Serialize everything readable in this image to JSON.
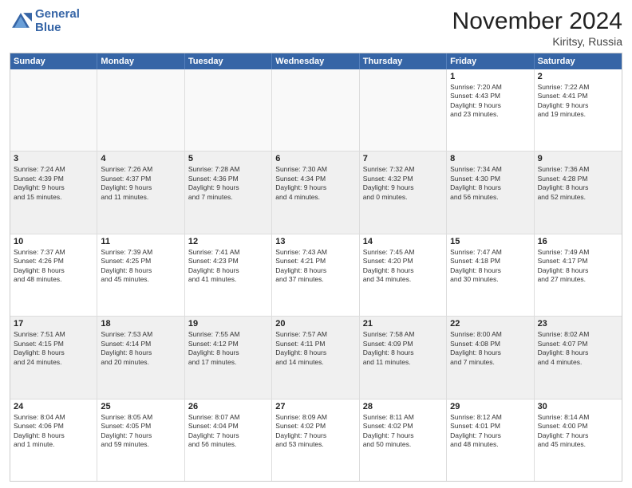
{
  "header": {
    "logo_line1": "General",
    "logo_line2": "Blue",
    "month_title": "November 2024",
    "location": "Kiritsy, Russia"
  },
  "weekdays": [
    "Sunday",
    "Monday",
    "Tuesday",
    "Wednesday",
    "Thursday",
    "Friday",
    "Saturday"
  ],
  "rows": [
    [
      {
        "day": "",
        "info": ""
      },
      {
        "day": "",
        "info": ""
      },
      {
        "day": "",
        "info": ""
      },
      {
        "day": "",
        "info": ""
      },
      {
        "day": "",
        "info": ""
      },
      {
        "day": "1",
        "info": "Sunrise: 7:20 AM\nSunset: 4:43 PM\nDaylight: 9 hours\nand 23 minutes."
      },
      {
        "day": "2",
        "info": "Sunrise: 7:22 AM\nSunset: 4:41 PM\nDaylight: 9 hours\nand 19 minutes."
      }
    ],
    [
      {
        "day": "3",
        "info": "Sunrise: 7:24 AM\nSunset: 4:39 PM\nDaylight: 9 hours\nand 15 minutes."
      },
      {
        "day": "4",
        "info": "Sunrise: 7:26 AM\nSunset: 4:37 PM\nDaylight: 9 hours\nand 11 minutes."
      },
      {
        "day": "5",
        "info": "Sunrise: 7:28 AM\nSunset: 4:36 PM\nDaylight: 9 hours\nand 7 minutes."
      },
      {
        "day": "6",
        "info": "Sunrise: 7:30 AM\nSunset: 4:34 PM\nDaylight: 9 hours\nand 4 minutes."
      },
      {
        "day": "7",
        "info": "Sunrise: 7:32 AM\nSunset: 4:32 PM\nDaylight: 9 hours\nand 0 minutes."
      },
      {
        "day": "8",
        "info": "Sunrise: 7:34 AM\nSunset: 4:30 PM\nDaylight: 8 hours\nand 56 minutes."
      },
      {
        "day": "9",
        "info": "Sunrise: 7:36 AM\nSunset: 4:28 PM\nDaylight: 8 hours\nand 52 minutes."
      }
    ],
    [
      {
        "day": "10",
        "info": "Sunrise: 7:37 AM\nSunset: 4:26 PM\nDaylight: 8 hours\nand 48 minutes."
      },
      {
        "day": "11",
        "info": "Sunrise: 7:39 AM\nSunset: 4:25 PM\nDaylight: 8 hours\nand 45 minutes."
      },
      {
        "day": "12",
        "info": "Sunrise: 7:41 AM\nSunset: 4:23 PM\nDaylight: 8 hours\nand 41 minutes."
      },
      {
        "day": "13",
        "info": "Sunrise: 7:43 AM\nSunset: 4:21 PM\nDaylight: 8 hours\nand 37 minutes."
      },
      {
        "day": "14",
        "info": "Sunrise: 7:45 AM\nSunset: 4:20 PM\nDaylight: 8 hours\nand 34 minutes."
      },
      {
        "day": "15",
        "info": "Sunrise: 7:47 AM\nSunset: 4:18 PM\nDaylight: 8 hours\nand 30 minutes."
      },
      {
        "day": "16",
        "info": "Sunrise: 7:49 AM\nSunset: 4:17 PM\nDaylight: 8 hours\nand 27 minutes."
      }
    ],
    [
      {
        "day": "17",
        "info": "Sunrise: 7:51 AM\nSunset: 4:15 PM\nDaylight: 8 hours\nand 24 minutes."
      },
      {
        "day": "18",
        "info": "Sunrise: 7:53 AM\nSunset: 4:14 PM\nDaylight: 8 hours\nand 20 minutes."
      },
      {
        "day": "19",
        "info": "Sunrise: 7:55 AM\nSunset: 4:12 PM\nDaylight: 8 hours\nand 17 minutes."
      },
      {
        "day": "20",
        "info": "Sunrise: 7:57 AM\nSunset: 4:11 PM\nDaylight: 8 hours\nand 14 minutes."
      },
      {
        "day": "21",
        "info": "Sunrise: 7:58 AM\nSunset: 4:09 PM\nDaylight: 8 hours\nand 11 minutes."
      },
      {
        "day": "22",
        "info": "Sunrise: 8:00 AM\nSunset: 4:08 PM\nDaylight: 8 hours\nand 7 minutes."
      },
      {
        "day": "23",
        "info": "Sunrise: 8:02 AM\nSunset: 4:07 PM\nDaylight: 8 hours\nand 4 minutes."
      }
    ],
    [
      {
        "day": "24",
        "info": "Sunrise: 8:04 AM\nSunset: 4:06 PM\nDaylight: 8 hours\nand 1 minute."
      },
      {
        "day": "25",
        "info": "Sunrise: 8:05 AM\nSunset: 4:05 PM\nDaylight: 7 hours\nand 59 minutes."
      },
      {
        "day": "26",
        "info": "Sunrise: 8:07 AM\nSunset: 4:04 PM\nDaylight: 7 hours\nand 56 minutes."
      },
      {
        "day": "27",
        "info": "Sunrise: 8:09 AM\nSunset: 4:02 PM\nDaylight: 7 hours\nand 53 minutes."
      },
      {
        "day": "28",
        "info": "Sunrise: 8:11 AM\nSunset: 4:02 PM\nDaylight: 7 hours\nand 50 minutes."
      },
      {
        "day": "29",
        "info": "Sunrise: 8:12 AM\nSunset: 4:01 PM\nDaylight: 7 hours\nand 48 minutes."
      },
      {
        "day": "30",
        "info": "Sunrise: 8:14 AM\nSunset: 4:00 PM\nDaylight: 7 hours\nand 45 minutes."
      }
    ]
  ]
}
